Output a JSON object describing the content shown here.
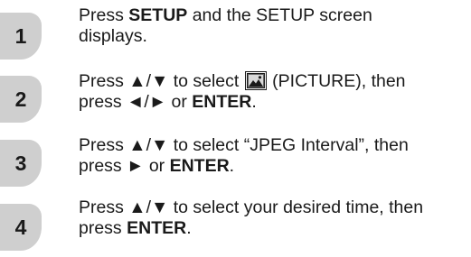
{
  "steps": [
    {
      "number": "1",
      "parts": {
        "a": "Press ",
        "b": "SETUP",
        "c": " and the SETUP screen",
        "d": "displays."
      }
    },
    {
      "number": "2",
      "parts": {
        "a": "Press ▲/▼ to select ",
        "icon": "picture-icon",
        "b": " (PICTURE), then",
        "c": "press ◄/► or ",
        "d": "ENTER",
        "e": "."
      }
    },
    {
      "number": "3",
      "parts": {
        "a": "Press ▲/▼ to select “JPEG Interval”, then",
        "b": "press ► or ",
        "c": "ENTER",
        "d": "."
      }
    },
    {
      "number": "4",
      "parts": {
        "a": "Press ▲/▼ to select your desired time, then",
        "b": "press ",
        "c": "ENTER",
        "d": "."
      }
    }
  ]
}
